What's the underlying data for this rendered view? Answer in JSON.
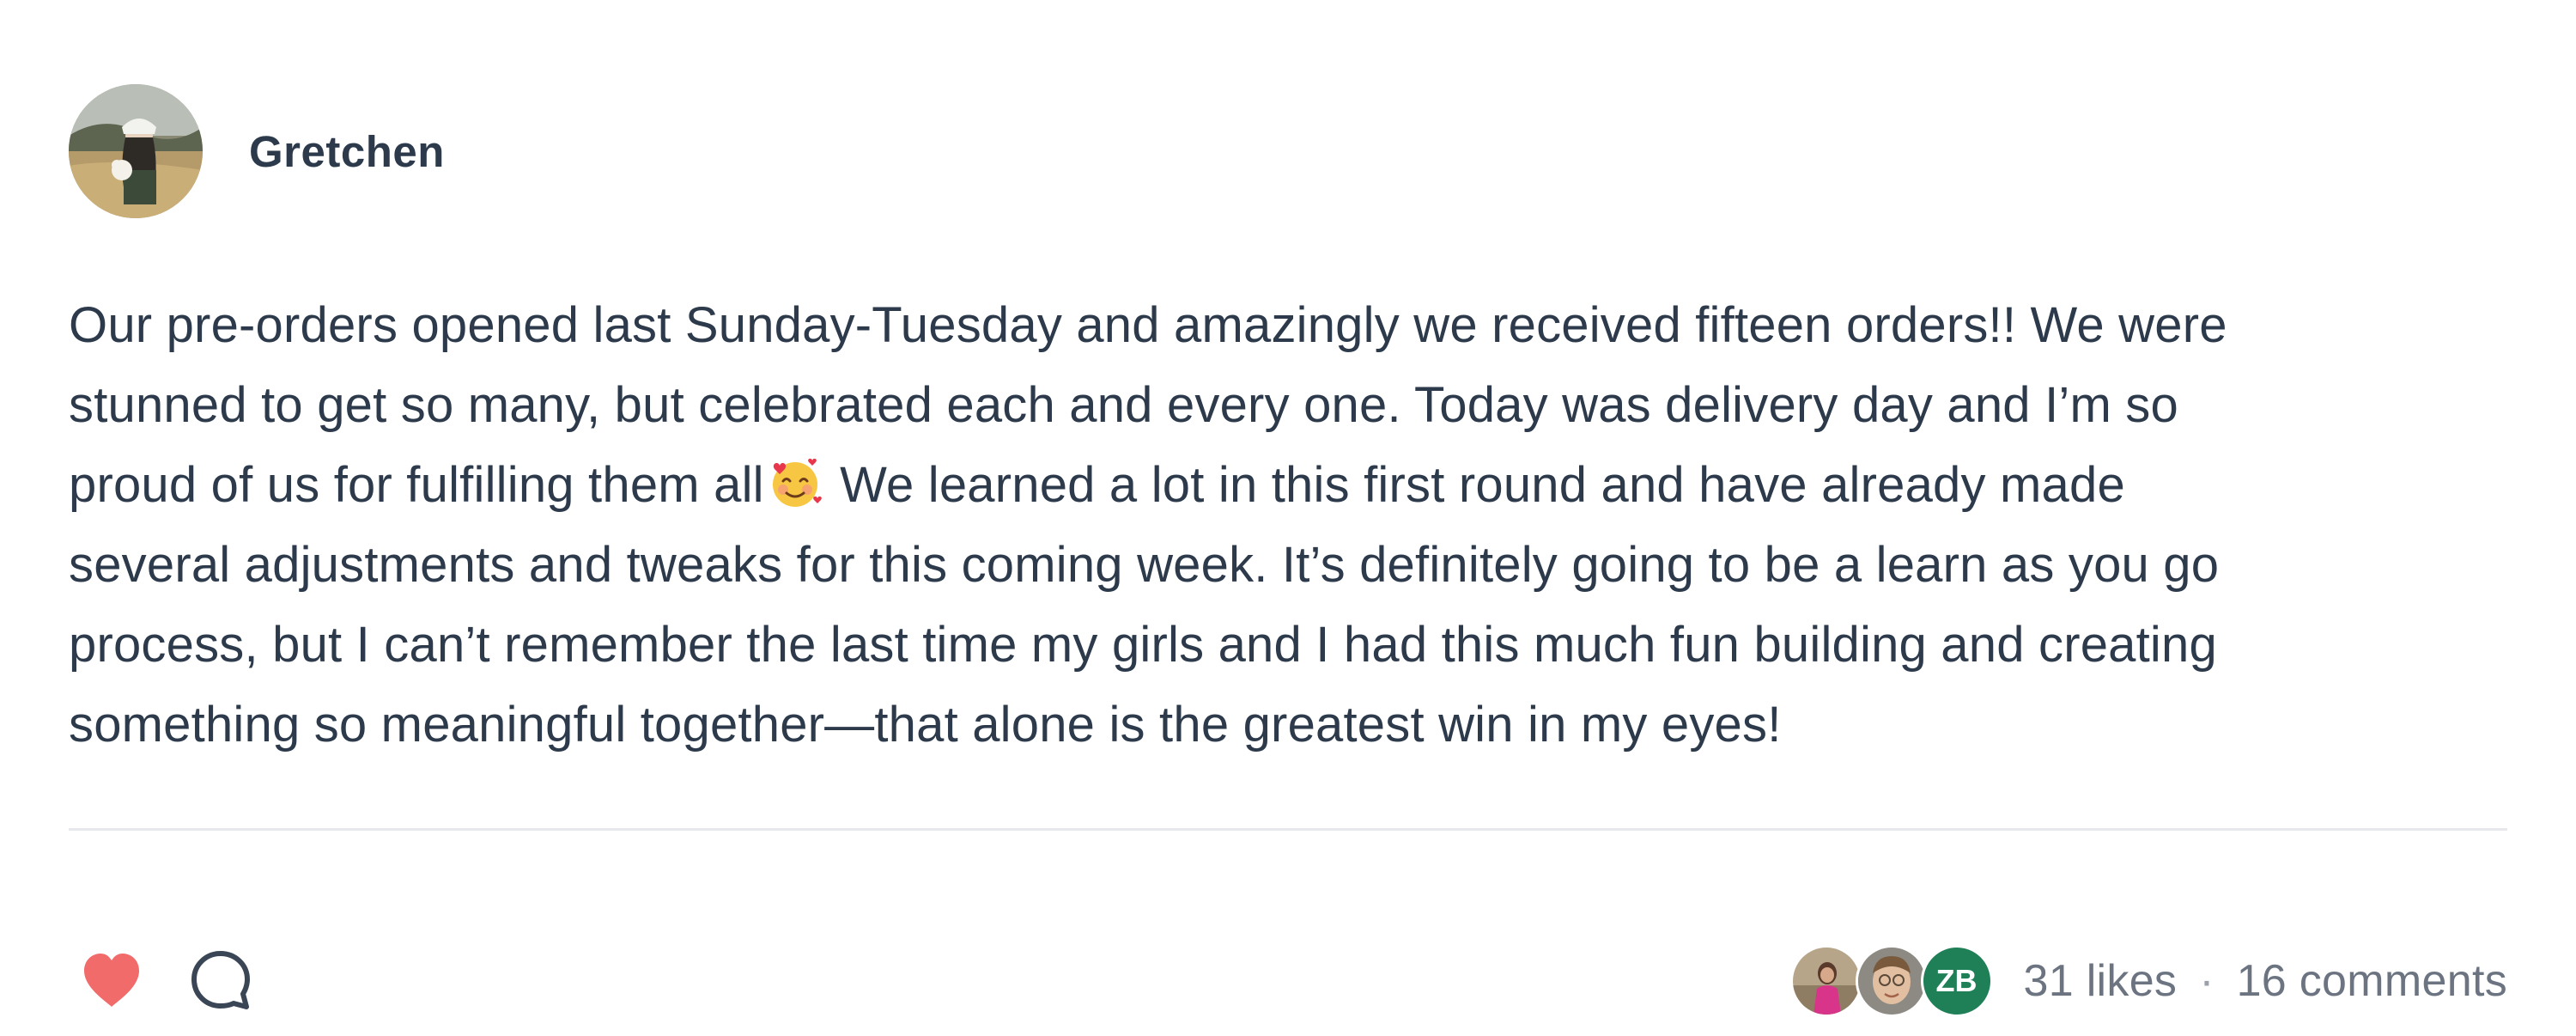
{
  "post": {
    "author": "Gretchen",
    "author_avatar": "author-photo",
    "body_lines": [
      "Our pre-orders opened last Sunday-Tuesday and amazingly we received fifteen orders!! We were",
      "stunned to get so many, but celebrated each and every one. Today was delivery day and I’m so",
      "proud of us for fulfilling them all",
      " We learned a lot in this first round and have already made",
      "several adjustments and tweaks for this coming week. It’s definitely going to be a learn as you go",
      "process, but I can’t remember the last time my girls and I had this much fun building and creating",
      "something so meaningful together—that alone is the greatest win in my eyes!"
    ],
    "emoji": "smiling-face-with-hearts"
  },
  "footer": {
    "like_icon": "heart-icon",
    "comment_icon": "comment-bubble-icon",
    "likers": [
      {
        "type": "photo",
        "name": "liker-avatar-1"
      },
      {
        "type": "photo",
        "name": "liker-avatar-2"
      },
      {
        "type": "initials",
        "initials": "ZB"
      }
    ],
    "likes": "31 likes",
    "separator": "·",
    "comments": "16 comments"
  },
  "colors": {
    "text": "#2c3a4b",
    "muted": "#6b7480",
    "heart": "#f26b6b",
    "initials_bg": "#1f7f57",
    "divider": "#e6e8eb"
  }
}
